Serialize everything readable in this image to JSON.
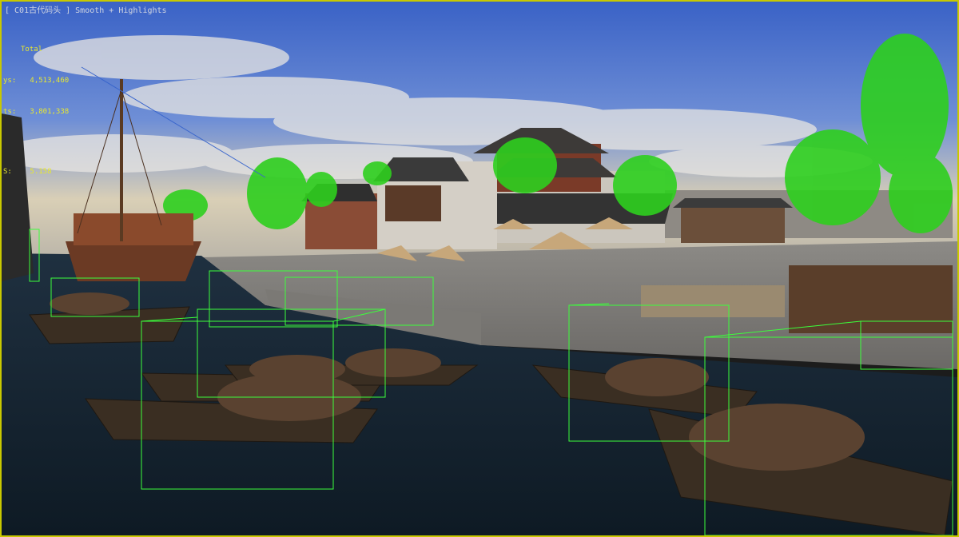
{
  "viewport": {
    "title": "[ C01古代码头 ] Smooth + Highlights",
    "stats": {
      "header": "Total",
      "polys_label": "ys:",
      "polys_value": "4,513,460",
      "verts_label": "ts:",
      "verts_value": "3,801,338",
      "fps_label": "S:",
      "fps_value": "5.158"
    },
    "border_color": "#c8c800",
    "bbox_color": "#3cff3c",
    "stats_color": "#e8e830"
  }
}
